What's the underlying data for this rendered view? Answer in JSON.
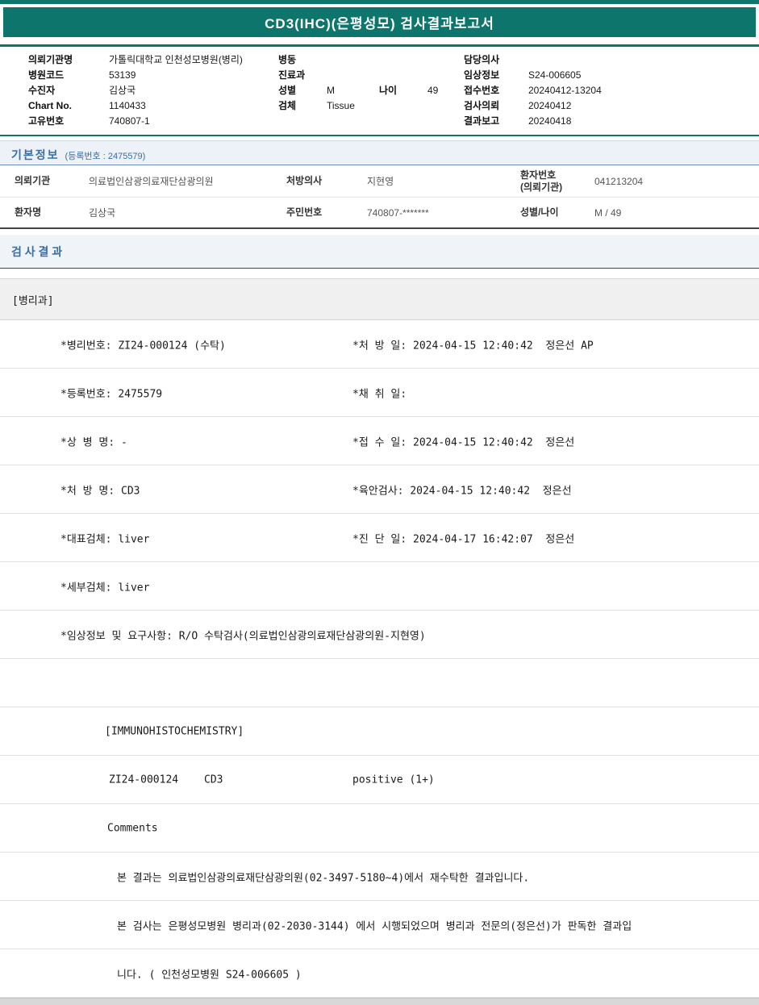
{
  "title": "CD3(IHC)(은평성모) 검사결과보고서",
  "colors": {
    "accent_teal": "#0d756b",
    "section_blue": "#3a6ea5"
  },
  "header": {
    "left": [
      {
        "label": "의뢰기관명",
        "value": "가톨릭대학교 인천성모병원(병리)"
      },
      {
        "label": "병원코드",
        "value": "53139"
      },
      {
        "label": "수진자",
        "value": "김상국"
      },
      {
        "label": "Chart No.",
        "value": "1140433"
      },
      {
        "label": "고유번호",
        "value": "740807-1"
      }
    ],
    "middle": {
      "ward_label": "병동",
      "ward_value": "",
      "dept_label": "진료과",
      "dept_value": "",
      "sex_label": "성별",
      "sex_value": "M",
      "age_label": "나이",
      "age_value": "49",
      "specimen_label": "검체",
      "specimen_value": "Tissue"
    },
    "right": [
      {
        "label": "담당의사",
        "value": ""
      },
      {
        "label": "임상정보",
        "value": "S24-006605"
      },
      {
        "label": "접수번호",
        "value": "20240412-13204"
      },
      {
        "label": "검사의뢰",
        "value": "20240412"
      },
      {
        "label": "결과보고",
        "value": "20240418"
      }
    ]
  },
  "basic_info": {
    "title": "기본정보",
    "subtitle": "(등록번호 : 2475579)",
    "row1": {
      "c1_label": "의뢰기관",
      "c1_value": "의료법인삼광의료재단삼광의원",
      "c2_label": "처방의사",
      "c2_value": "지현영",
      "c3_label_line1": "환자번호",
      "c3_label_line2": "(의뢰기관)",
      "c3_value": "041213204"
    },
    "row2": {
      "c1_label": "환자명",
      "c1_value": "김상국",
      "c2_label": "주민번호",
      "c2_value": "740807-*******",
      "c3_label": "성별/나이",
      "c3_value": "M / 49"
    }
  },
  "result": {
    "title": "검 사 결 과",
    "department": "[병리과]",
    "detail_rows": [
      {
        "left": "*병리번호: ZI24-000124 (수탁)",
        "right": "*처 방 일: 2024-04-15 12:40:42  정은선 AP"
      },
      {
        "left": "*등록번호: 2475579",
        "right": "*채 취 일:"
      },
      {
        "left": "*상 병 명: -",
        "right": "*접 수 일: 2024-04-15 12:40:42  정은선"
      },
      {
        "left": "*처 방 명: CD3",
        "right": "*육안검사: 2024-04-15 12:40:42  정은선"
      },
      {
        "left": "*대표검체: liver",
        "right": "*진 단 일: 2024-04-17 16:42:07  정은선"
      },
      {
        "left": "*세부검체: liver",
        "right": ""
      },
      {
        "left": "*임상정보 및 요구사항: R/O 수탁검사(의료법인삼광의료재단삼광의원-지현영)",
        "right": ""
      },
      {
        "left": "",
        "right": ""
      }
    ],
    "ihc_header": "[IMMUNOHISTOCHEMISTRY]",
    "ihc_result": {
      "slide_no": "ZI24-000124",
      "test_name": "CD3",
      "result_value": "positive (1+)"
    },
    "comments_label": "Comments",
    "comments": [
      "본 결과는 의료법인삼광의료재단삼광의원(02-3497-5180~4)에서 재수탁한 결과입니다.",
      "본 검사는 은평성모병원 병리과(02-2030-3144) 에서 시행되었으며 병리과 전문의(정은선)가 판독한 결과입",
      "니다. ( 인천성모병원 S24-006605 )"
    ]
  }
}
